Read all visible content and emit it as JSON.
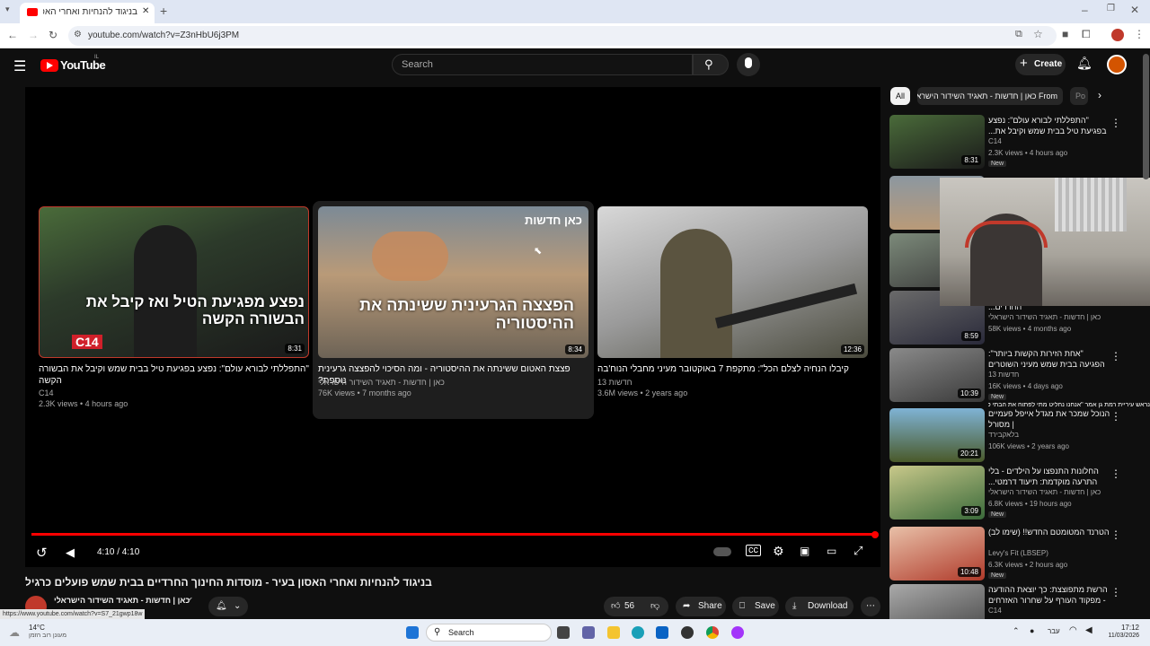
{
  "browser": {
    "tab_title": "בניגוד להנחיות ואחרי האסון בעיר...",
    "url": "youtube.com/watch?v=Z3nHbU6j3PM",
    "status_url": "https://www.youtube.com/watch?v=S7_21gwp18w"
  },
  "yt": {
    "logo_text": "YouTube",
    "region": "IL",
    "search_placeholder": "Search",
    "create_label": "Create"
  },
  "end_cards": [
    {
      "title": "\"התפללתי לבורא עולם\": נפצע בפגיעת טיל בבית שמש וקיבל את הבשורה הקשה",
      "channel": "C14",
      "meta": "2.3K views • 4 hours ago",
      "duration": "8:31",
      "thumb_text": "נפצע מפגיעת הטיל ואז קיבל את הבשורה הקשה",
      "badge": "C14"
    },
    {
      "title": "פצצת האטום ששינתה את ההיסטוריה - ומה הסיכוי להפצצה גרעינית נוספת?",
      "channel": "כאן | חדשות - תאגיד השידור הישראלי",
      "meta": "76K views • 7 months ago",
      "duration": "8:34",
      "thumb_text": "הפצצה הגרעינית ששינתה את ההיסטוריה",
      "badge": "כאן חדשות"
    },
    {
      "title": "קיבלו הנחיה לצלם הכל\": מתקפת 7 באוקטובר מעיני מחבלי הנוח'בה",
      "channel": "13 חדשות",
      "meta": "3.6M views • 2 years ago",
      "duration": "12:36",
      "thumb_text": "",
      "badge": ""
    }
  ],
  "player": {
    "time": "4:10 / 4:10",
    "progress": 1.0
  },
  "video": {
    "title": "בניגוד להנחיות ואחרי האסון בעיר - מוסדות החינוך החרדיים בבית שמש פועלים כרגיל",
    "channel": "כאן | חדשות - תאגיד השידור הישראלי",
    "likes": "56",
    "share_label": "Share",
    "save_label": "Save",
    "download_label": "Download"
  },
  "chips": [
    "All",
    "From כאן | חדשות - תאגיד השידור הישראלי",
    "Po"
  ],
  "recommendations": [
    {
      "title": "\"התפללתי לבורא עולם\": נפצע בפגיעת טיל בבית שמש וקיבל את...",
      "channel": "C14",
      "views": "2.3K views • 4 hours ago",
      "duration": "8:31",
      "new": "New"
    },
    {
      "title": "",
      "channel": "",
      "views": "",
      "duration": "",
      "new": ""
    },
    {
      "title": "",
      "channel": "",
      "views": "",
      "duration": "",
      "new": ""
    },
    {
      "title": "הקהות מהפגנת העמק של החרדים...",
      "channel": "כאן | חדשות - תאגיד השידור הישראלי",
      "views": "58K views • 4 months ago",
      "duration": "8:59",
      "new": ""
    },
    {
      "title": "\"אחת הזירות הקשות ביותר\": הפגיעה בבית שמש מעיני השוטרים",
      "channel": "13 חדשות",
      "views": "16K views • 4 days ago",
      "duration": "10:39",
      "new": "New"
    },
    {
      "title": "הנוכל שמכר את מגדל אייפל פעמיים | מסורל",
      "channel": "בלאקבירד",
      "views": "106K views • 2 years ago",
      "duration": "20:21",
      "new": ""
    },
    {
      "title": "החלונות התנפצו על הילדים - בלי התרעה מוקדמת: תיעוד דרמטי...",
      "channel": "כאן | חדשות - תאגיד השידור הישראלי",
      "views": "6.8K views • 19 hours ago",
      "duration": "3:09",
      "new": "New"
    },
    {
      "title": "הטרנד המטומטם החדש!! (שימו לב)",
      "channel": "Levy's Fit (LBSEP)",
      "views": "6.3K views • 2 hours ago",
      "duration": "10:48",
      "new": "New"
    },
    {
      "title": "הרשת מתפוצצת: כך יוצאת ההודעה - מפקוד העורף על שחרור האזרחים",
      "channel": "C14",
      "views": "",
      "duration": "",
      "new": ""
    }
  ],
  "overlay_banner": "נראש עיריית רמת גן אמר \"אנחנו נחליט מתי לפתוח את הבתי ספר\"",
  "taskbar": {
    "weather_temp": "14°C",
    "weather_desc": "מעונן רוב הזמן",
    "search_label": "Search",
    "lang": "עבר",
    "time": "17:12",
    "date": "11/03/2026"
  },
  "colors": {
    "accent_red": "#ff0000",
    "bg": "#0f0f0f"
  }
}
